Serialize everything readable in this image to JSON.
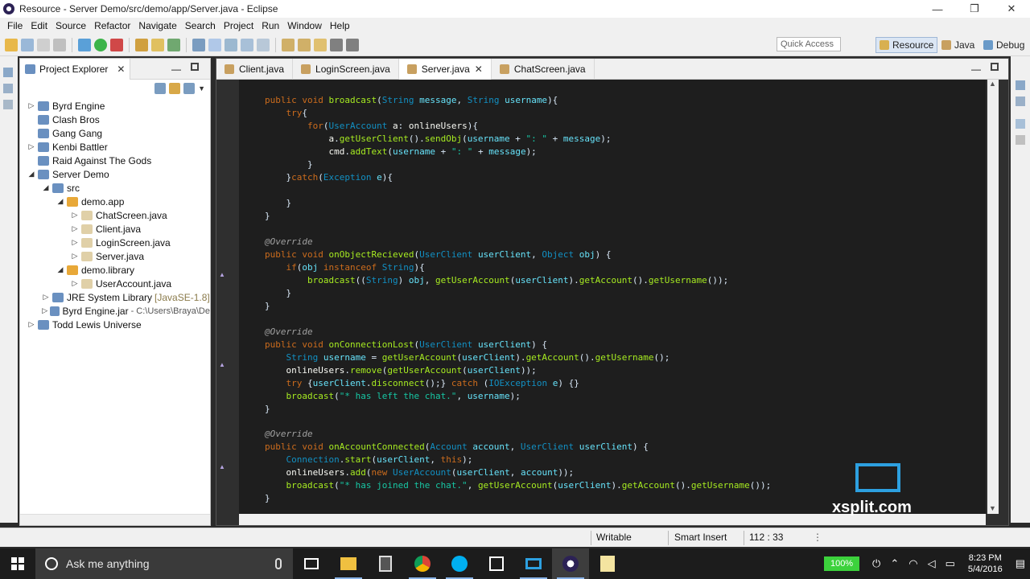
{
  "window": {
    "title": "Resource - Server Demo/src/demo/app/Server.java - Eclipse",
    "minimize": "—",
    "maximize": "❐",
    "close": "✕"
  },
  "menu": [
    "File",
    "Edit",
    "Source",
    "Refactor",
    "Navigate",
    "Search",
    "Project",
    "Run",
    "Window",
    "Help"
  ],
  "toolbar": {
    "quick_access": "Quick Access",
    "perspectives": [
      "Resource",
      "Java",
      "Debug"
    ]
  },
  "explorer": {
    "title": "Project Explorer",
    "close": "✕",
    "tree": [
      {
        "label": "Byrd Engine",
        "arrow": "▷",
        "indent": 0
      },
      {
        "label": "Clash Bros",
        "arrow": "",
        "indent": 0
      },
      {
        "label": "Gang Gang",
        "arrow": "",
        "indent": 0
      },
      {
        "label": "Kenbi Battler",
        "arrow": "▷",
        "indent": 0
      },
      {
        "label": "Raid Against The Gods",
        "arrow": "",
        "indent": 0
      },
      {
        "label": "Server Demo",
        "arrow": "◢",
        "indent": 0
      },
      {
        "label": "src",
        "arrow": "◢",
        "indent": 1
      },
      {
        "label": "demo.app",
        "arrow": "◢",
        "indent": 2
      },
      {
        "label": "ChatScreen.java",
        "arrow": "▷",
        "indent": 3
      },
      {
        "label": "Client.java",
        "arrow": "▷",
        "indent": 3
      },
      {
        "label": "LoginScreen.java",
        "arrow": "▷",
        "indent": 3
      },
      {
        "label": "Server.java",
        "arrow": "▷",
        "indent": 3
      },
      {
        "label": "demo.library",
        "arrow": "◢",
        "indent": 2
      },
      {
        "label": "UserAccount.java",
        "arrow": "▷",
        "indent": 3
      },
      {
        "label": "JRE System Library",
        "hint": "[JavaSE-1.8]",
        "arrow": "▷",
        "indent": 1
      },
      {
        "label": "Byrd Engine.jar",
        "hint2": "- C:\\Users\\Braya\\De",
        "arrow": "▷",
        "indent": 1
      },
      {
        "label": "Todd Lewis Universe",
        "arrow": "▷",
        "indent": 0
      }
    ]
  },
  "editor": {
    "tabs": [
      "Client.java",
      "LoginScreen.java",
      "Server.java",
      "ChatScreen.java"
    ],
    "active_tab": "Server.java",
    "tab_close": "✕"
  },
  "status": {
    "mode": "Writable",
    "insert": "Smart Insert",
    "position": "112 : 33"
  },
  "watermark": "xsplit.com",
  "taskbar": {
    "search_placeholder": "Ask me anything",
    "battery": "100%",
    "time": "8:23 PM",
    "date": "5/4/2016"
  },
  "colors": {
    "keyword": "#cc6c1d",
    "type": "#1290c3",
    "string": "#17c6a3",
    "method": "#a7ec21",
    "variable": "#66e1f8"
  }
}
